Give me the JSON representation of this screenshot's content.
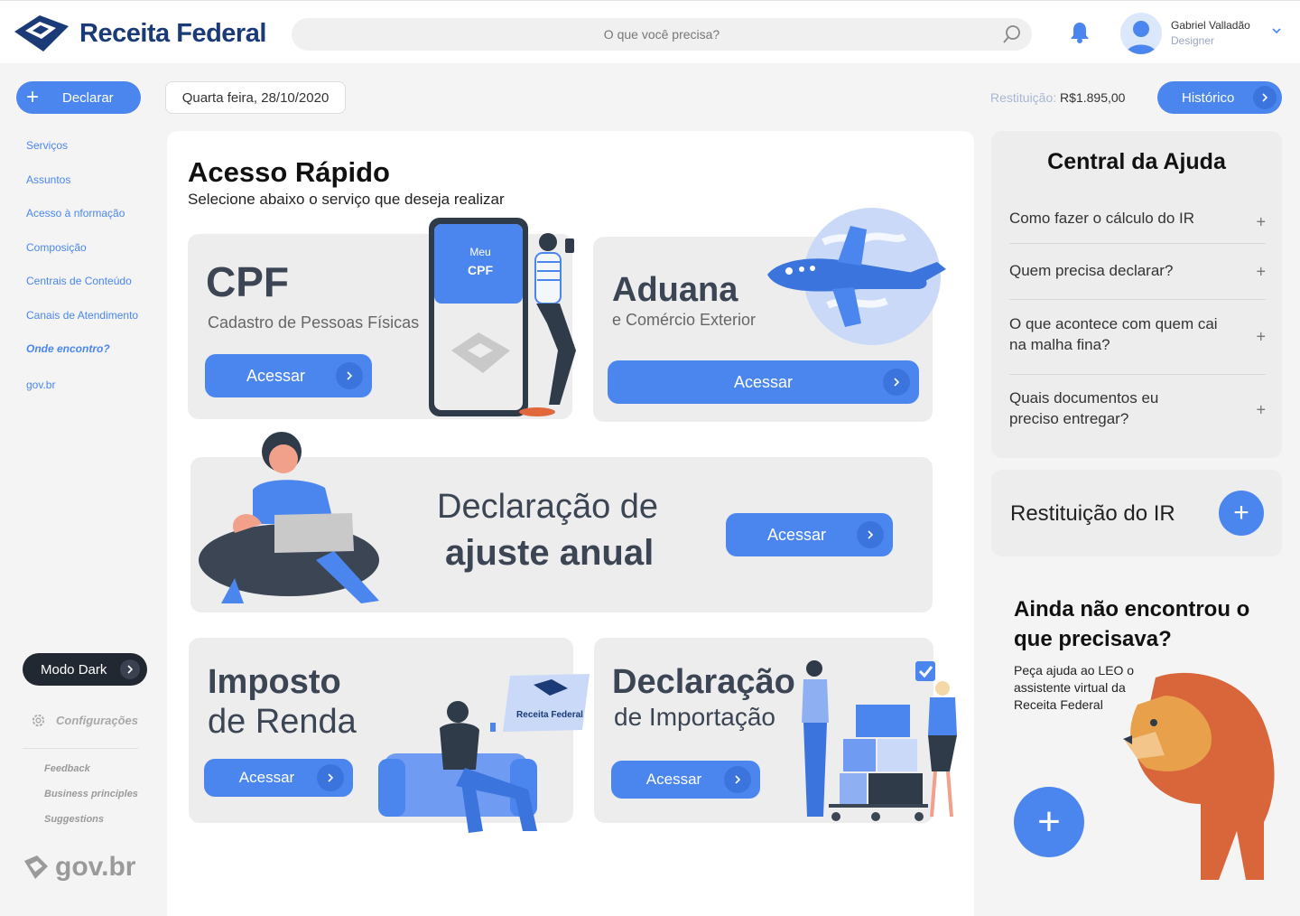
{
  "header": {
    "brand": "Receita Federal",
    "search_placeholder": "O que você precisa?",
    "user_name": "Gabriel Valladão",
    "user_role": "Designer"
  },
  "toolbar": {
    "declarar_label": "Declarar",
    "date": "Quarta feira, 28/10/2020",
    "restituicao_label": "Restituição:",
    "restituicao_value": "R$1.895,00",
    "historico_label": "Histórico"
  },
  "sidebar": {
    "items": [
      {
        "label": "Serviços"
      },
      {
        "label": "Assuntos"
      },
      {
        "label": "Acesso à nformação"
      },
      {
        "label": "Composição"
      },
      {
        "label": "Centrais de Conteúdo"
      },
      {
        "label": "Canais de Atendimento"
      },
      {
        "label": "Onde encontro?"
      },
      {
        "label": "gov.br"
      }
    ],
    "modo_dark": "Modo Dark",
    "config": "Configurações",
    "footer_links": [
      "Feedback",
      "Business principles",
      "Suggestions"
    ],
    "govbr": "gov.br"
  },
  "main": {
    "title": "Acesso Rápido",
    "subtitle": "Selecione abaixo o serviço que deseja realizar",
    "phone_line1": "Meu",
    "phone_line2": "CPF",
    "cards": {
      "cpf": {
        "title": "CPF",
        "subtitle": "Cadastro de Pessoas Físicas",
        "button": "Acessar"
      },
      "aduana": {
        "title": "Aduana",
        "subtitle": "e Comércio Exterior",
        "button": "Acessar"
      },
      "declaracao": {
        "line1": "Declaração de",
        "line2": "ajuste anual",
        "button": "Acessar"
      },
      "imposto": {
        "line1": "Imposto",
        "line2": "de Renda",
        "button": "Acessar",
        "sign": "Receita Federal"
      },
      "importacao": {
        "line1": "Declaração",
        "line2": "de Importação",
        "button": "Acessar"
      }
    }
  },
  "help": {
    "title": "Central da Ajuda",
    "faq": [
      "Como fazer o cálculo do IR",
      "Quem precisa declarar?",
      "O que acontece com quem cai na malha fina?",
      "Quais documentos eu preciso entregar?"
    ],
    "restituicao": "Restituição do IR",
    "ainda_title": "Ainda não encontrou o que precisava?",
    "ainda_sub": "Peça ajuda ao LEO o assistente virtual da Receita Federal"
  },
  "colors": {
    "accent": "#4b86ef",
    "brand": "#1a3a78",
    "card": "#ededee"
  }
}
